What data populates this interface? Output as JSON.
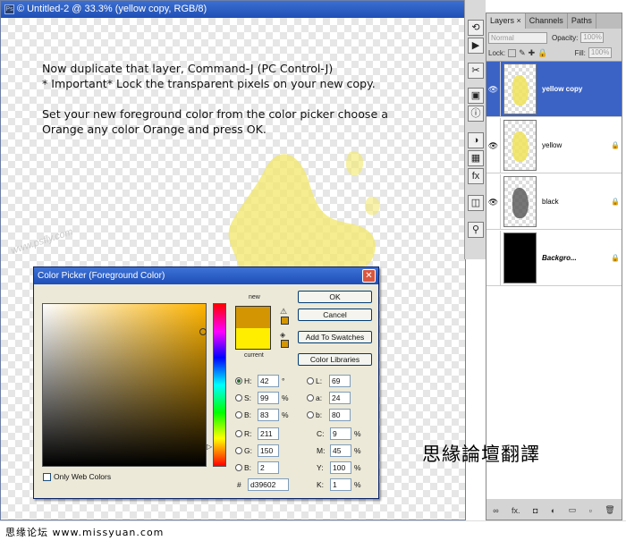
{
  "document": {
    "title": "Untitled-2 @ 33.3% (yellow copy, RGB/8)"
  },
  "instructions": {
    "line1": "Now duplicate that layer, Command-J (PC Control-J)",
    "line2": " * Important* Lock the transparent pixels on your new copy.",
    "line3": "Set your new foreground color from the color picker choose a",
    "line4": "Orange any color Orange and press OK."
  },
  "watermark": "www.psfly.com",
  "status": {
    "site_label": "思缘论坛  www.missyuan.com"
  },
  "caption": "思緣論壇翻譯",
  "layers_panel": {
    "tabs": [
      "Layers ×",
      "Channels",
      "Paths"
    ],
    "blend_mode": "Normal",
    "opacity_label": "Opacity:",
    "opacity_value": "100%",
    "lock_label": "Lock:",
    "fill_label": "Fill:",
    "fill_value": "100%",
    "layers": [
      {
        "name": "yellow copy",
        "active": true
      },
      {
        "name": "yellow",
        "active": false
      },
      {
        "name": "black",
        "active": false
      },
      {
        "name": "Backgro...",
        "active": false
      }
    ],
    "footer_icons": [
      "link-icon",
      "fx-icon",
      "mask-icon",
      "adjustment-icon",
      "group-icon",
      "new-layer-icon",
      "trash-icon"
    ],
    "footer_glyphs": [
      "∞",
      "fx.",
      "◘",
      "◐",
      "▭",
      "▫",
      "🗑"
    ]
  },
  "color_picker": {
    "title": "Color Picker (Foreground Color)",
    "new_label": "new",
    "current_label": "current",
    "new_color": "#d39602",
    "current_color": "#ffee00",
    "buttons": {
      "ok": "OK",
      "cancel": "Cancel",
      "add_to_swatches": "Add To Swatches",
      "color_libraries": "Color Libraries"
    },
    "fields": {
      "H": {
        "label": "H:",
        "value": "42",
        "unit": "°"
      },
      "S": {
        "label": "S:",
        "value": "99",
        "unit": "%"
      },
      "B": {
        "label": "B:",
        "value": "83",
        "unit": "%"
      },
      "R": {
        "label": "R:",
        "value": "211"
      },
      "G": {
        "label": "G:",
        "value": "150"
      },
      "Bl": {
        "label": "B:",
        "value": "2"
      },
      "L": {
        "label": "L:",
        "value": "69"
      },
      "a": {
        "label": "a:",
        "value": "24"
      },
      "b": {
        "label": "b:",
        "value": "80"
      },
      "C": {
        "label": "C:",
        "value": "9",
        "unit": "%"
      },
      "M": {
        "label": "M:",
        "value": "45",
        "unit": "%"
      },
      "Y": {
        "label": "Y:",
        "value": "100",
        "unit": "%"
      },
      "K": {
        "label": "K:",
        "value": "1",
        "unit": "%"
      },
      "hex_label": "#",
      "hex": "d39602"
    },
    "only_web_colors": "Only Web Colors"
  }
}
